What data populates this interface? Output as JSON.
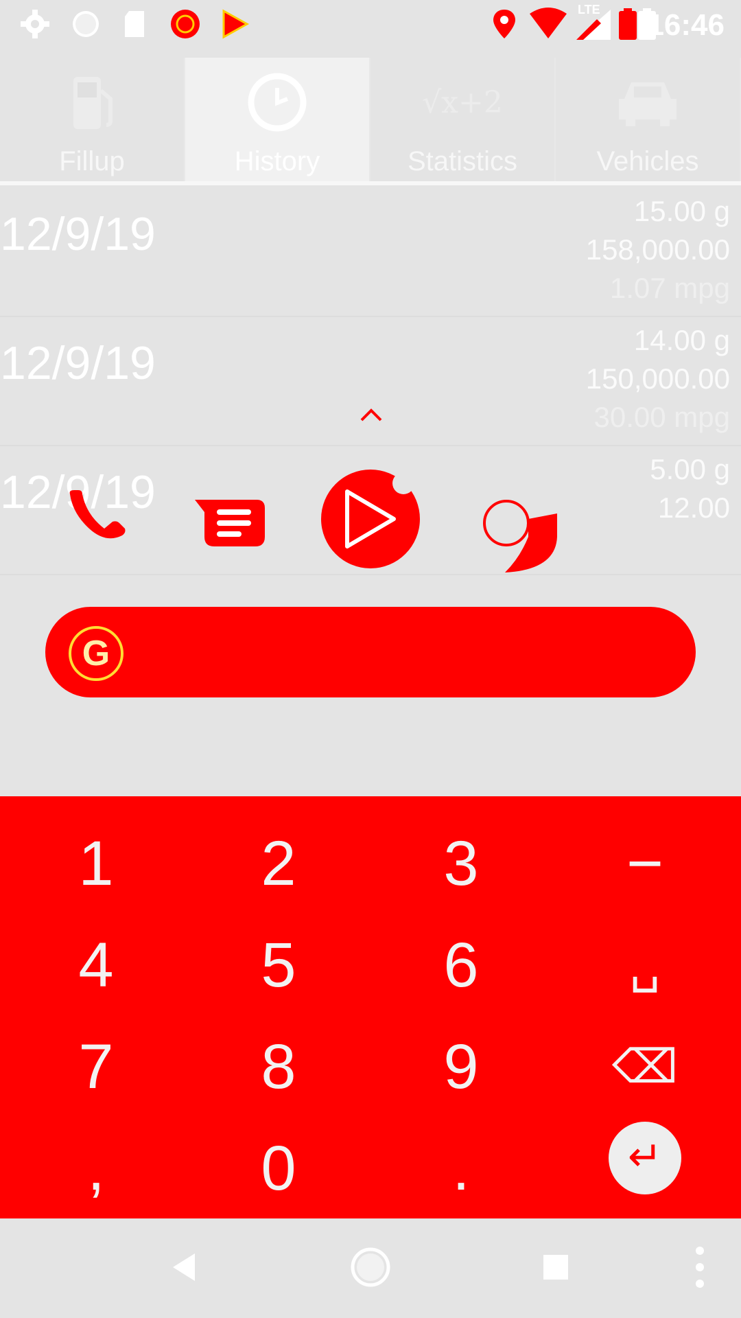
{
  "status_bar": {
    "time": "16:46",
    "icons": [
      "settings-icon",
      "circle-icon",
      "sd-card-icon",
      "target-icon",
      "play-store-icon",
      "location-icon",
      "wifi-icon",
      "lte-signal-icon",
      "battery-icon"
    ],
    "lte_label": "LTE"
  },
  "tabs": [
    {
      "label": "Fillup",
      "icon": "fuel-pump-icon",
      "active": false
    },
    {
      "label": "History",
      "icon": "clock-icon",
      "active": true
    },
    {
      "label": "Statistics",
      "icon": "sqrt-icon",
      "active": false
    },
    {
      "label": "Vehicles",
      "icon": "car-icon",
      "active": false
    }
  ],
  "stats_icon_text": "√x+2",
  "history": [
    {
      "date": "12/9/19",
      "gallons": "15.00 g",
      "odometer": "158,000.00",
      "mpg": "1.07 mpg"
    },
    {
      "date": "12/9/19",
      "gallons": "14.00 g",
      "odometer": "150,000.00",
      "mpg": "30.00 mpg"
    },
    {
      "date": "12/9/19",
      "gallons": "5.00 g",
      "odometer": "12.00",
      "mpg": ""
    }
  ],
  "dock": [
    "phone-icon",
    "messages-icon",
    "play-icon",
    "chrome-icon"
  ],
  "search": {
    "logo": "G"
  },
  "keypad": {
    "rows": [
      [
        "1",
        "2",
        "3",
        "−"
      ],
      [
        "4",
        "5",
        "6",
        "␣"
      ],
      [
        "7",
        "8",
        "9",
        "⌫"
      ],
      [
        ",",
        "0",
        ".",
        "↵"
      ]
    ]
  },
  "colors": {
    "accent": "#ff0000",
    "background": "#e4e4e4",
    "text": "#ffffff"
  }
}
